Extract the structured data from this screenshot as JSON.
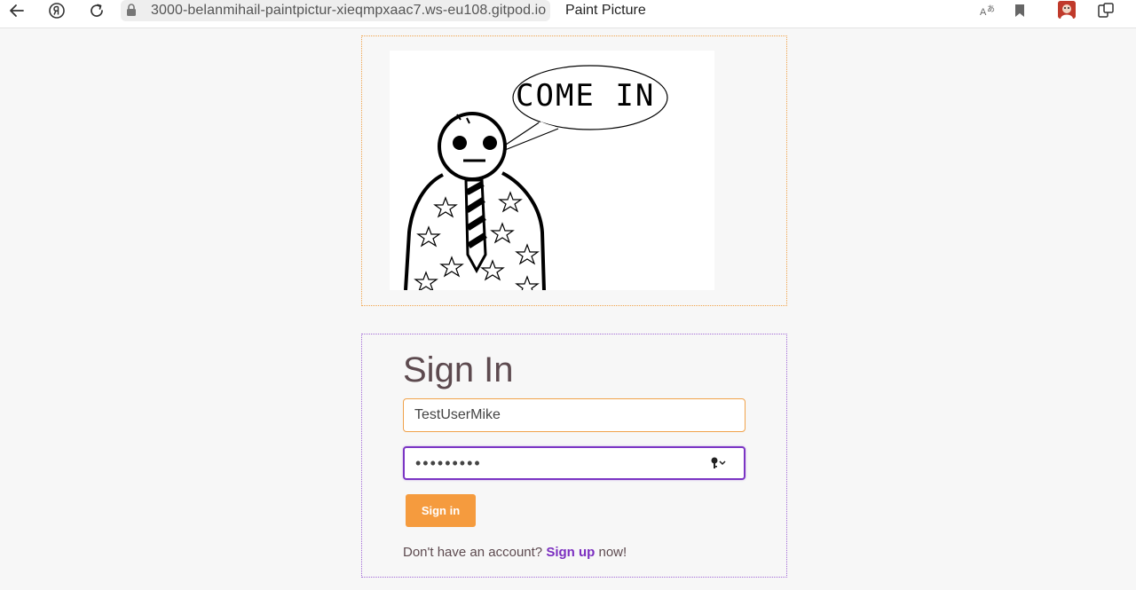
{
  "browser": {
    "url": "3000-belanmihail-paintpictur-xieqmpxaac7.ws-eu108.gitpod.io",
    "page_title": "Paint Picture",
    "icons": [
      "back-arrow-icon",
      "yandex-icon",
      "reload-icon",
      "lock-icon",
      "translate-icon",
      "bookmark-icon",
      "profile-avatar",
      "extensions-icon"
    ]
  },
  "picture": {
    "speech_text": "COME IN"
  },
  "signin": {
    "title": "Sign In",
    "username_value": "TestUserMike",
    "password_mask": "•••••••••",
    "button_label": "Sign in",
    "signup_prefix": "Don't have an account? ",
    "signup_link": "Sign up",
    "signup_suffix": " now!"
  },
  "colors": {
    "accent_orange": "#f59b3e",
    "accent_purple": "#7b35c4",
    "text_brown": "#5d4a4f"
  }
}
